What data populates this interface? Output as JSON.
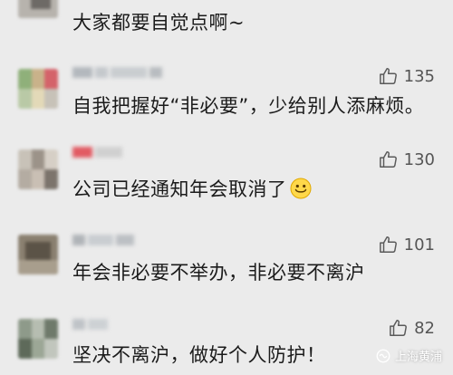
{
  "comments": [
    {
      "text": "大家都要自觉点啊~",
      "likes": ""
    },
    {
      "text": "自我把握好“非必要”，少给别人添麻烦。",
      "likes": "135"
    },
    {
      "text": "公司已经通知年会取消了",
      "likes": "130",
      "emoji": "smile-emoji"
    },
    {
      "text": "年会非必要不举办，非必要不离沪",
      "likes": "101"
    },
    {
      "text": "坚决不离沪，做好个人防护！",
      "likes": "82"
    }
  ],
  "watermark": {
    "text": "上海黄浦",
    "icon": "wechat-channel-icon"
  },
  "icons": {
    "like": "thumbs-up-icon"
  },
  "colors": {
    "background": "#ebebeb",
    "text": "#1b1b1b",
    "like_count": "#555555",
    "watermark": "#ffffff"
  }
}
